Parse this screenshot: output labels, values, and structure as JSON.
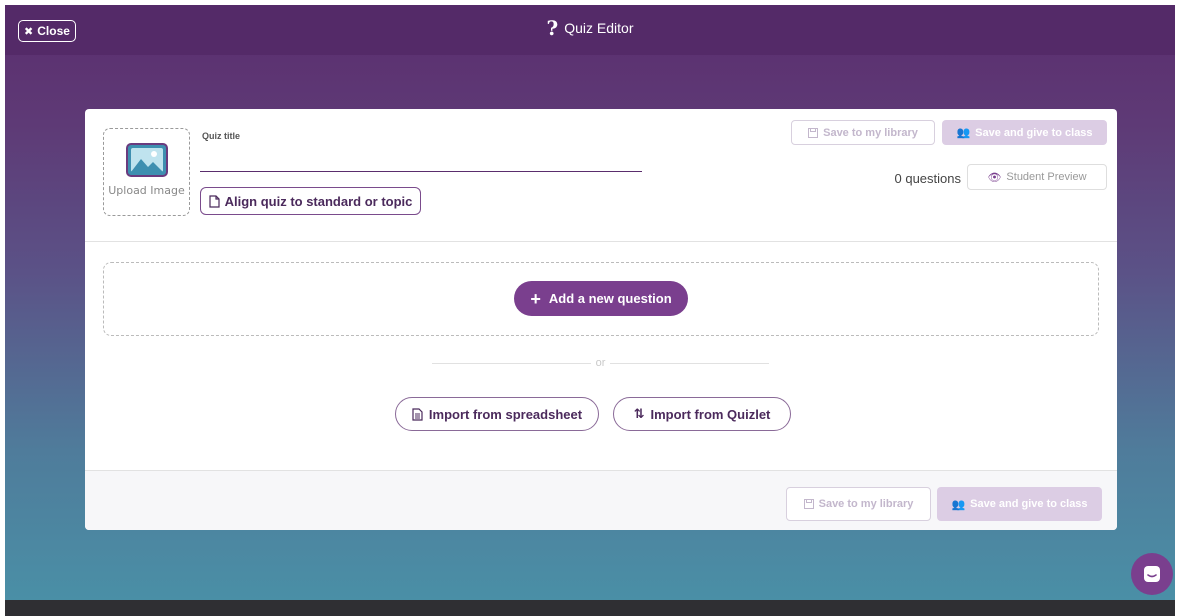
{
  "header": {
    "close_label": "Close",
    "title": "Quiz Editor",
    "title_icon": "question-mark-icon",
    "bg_color": "#542a68"
  },
  "quiz": {
    "upload_label": "Upload Image",
    "title_label": "Quiz title",
    "title_value": "",
    "align_label": "Align quiz to standard or topic",
    "save_library_label": "Save to my library",
    "save_class_label": "Save and give to class",
    "question_count": "0 questions",
    "preview_label": "Student Preview"
  },
  "body": {
    "add_question_label": "Add a new question",
    "or_label": "or",
    "import_spreadsheet_label": "Import from spreadsheet",
    "import_quizlet_label": "Import from Quizlet"
  },
  "footer": {
    "save_library_label": "Save to my library",
    "save_class_label": "Save and give to class"
  },
  "colors": {
    "accent": "#7a3f8e",
    "disabled_button": "#dccde4"
  }
}
